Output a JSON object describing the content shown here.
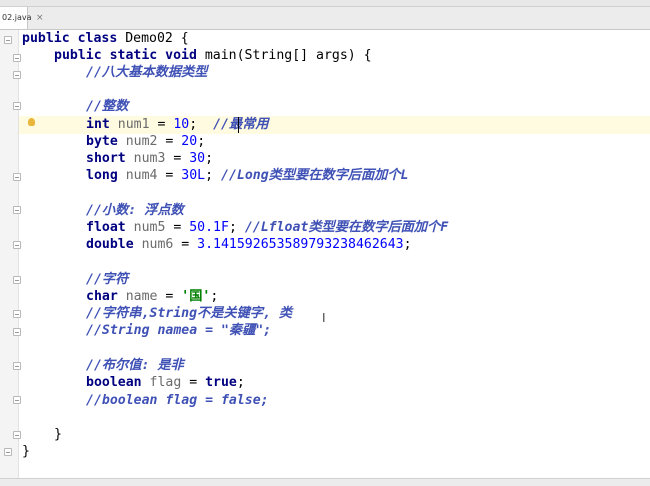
{
  "editor": {
    "tab_label": "02.java",
    "tab_close": "×",
    "lines": {
      "l1": {
        "a": "public class",
        "b": " Demo02 {"
      },
      "l2": {
        "a": "public static void",
        "b": " main(String[] args) {"
      },
      "l3": {
        "c": "//八大基本数据类型"
      },
      "l4": {
        "c": "//整数"
      },
      "l5": {
        "k": "int",
        "v": " num1",
        "e": " = ",
        "n": "10",
        "s": ";  ",
        "c": "//最常用"
      },
      "l6": {
        "k": "byte",
        "v": " num2",
        "e": " = ",
        "n": "20",
        "s": ";"
      },
      "l7": {
        "k": "short",
        "v": " num3",
        "e": " = ",
        "n": "30",
        "s": ";"
      },
      "l8": {
        "k": "long",
        "v": " num4",
        "e": " = ",
        "n": "30L",
        "s": "; ",
        "c": "//Long类型要在数字后面加个L"
      },
      "l9": {
        "c": "//小数: 浮点数"
      },
      "l10": {
        "k": "float",
        "v": " num5",
        "e": " = ",
        "n": "50.1F",
        "s": "; ",
        "c": "//Lfloat类型要在数字后面加个F"
      },
      "l11": {
        "k": "double",
        "v": " num6",
        "e": " = ",
        "n": "3.141592653589793238462643",
        "s": ";"
      },
      "l12": {
        "c": "//字符"
      },
      "l13": {
        "k": "char",
        "v": " name",
        "e": " = ",
        "str": "'国'",
        "s": ";"
      },
      "l14": {
        "c": "//字符串,String不是关键字, 类"
      },
      "l15": {
        "c": "//String namea = \"秦疆\";"
      },
      "l16": {
        "c": "//布尔值: 是非"
      },
      "l17": {
        "k": "boolean",
        "v": " flag",
        "e": " = ",
        "t": "true",
        "s": ";"
      },
      "l18": {
        "c": "//boolean flag = false;"
      },
      "l19": {
        "p": "}"
      },
      "l20": {
        "p": "}"
      }
    }
  },
  "icons": {
    "bulb": "intention-bulb-icon",
    "cursor": "text-cursor-icon"
  },
  "colors": {
    "keyword": "#000080",
    "number": "#0000ff",
    "comment": "#3f51b5",
    "string": "#008000",
    "variable": "#6b6b6b"
  }
}
